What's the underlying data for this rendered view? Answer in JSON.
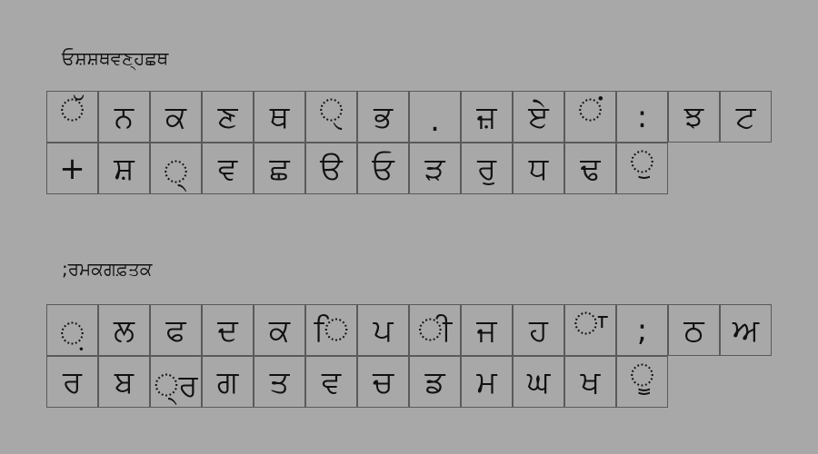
{
  "keyboards": [
    {
      "label": "ਓਸ਼ਸ਼ਥਵਣ੍ਹਛਥ",
      "rows": [
        [
          "ੱ",
          "ਨ",
          "ਕ",
          "ਣ",
          "ਥ",
          "ੑ",
          "ਭ",
          ".",
          "ਜ਼",
          "ਏ",
          "ਂ",
          ":",
          "ਝ",
          "ਟ"
        ],
        [
          "+",
          "ਸ਼",
          "੍",
          "ਵ",
          "ਛ",
          "ੳ",
          "ਓ",
          "ੜ",
          "ਰੁ",
          "ਧ",
          "ਢ",
          "ੁ"
        ]
      ]
    },
    {
      "label": ";ਰਮਕਗਫ਼ਤਕ",
      "rows": [
        [
          "਼",
          "ਲ",
          "ਫ",
          "ਦ",
          "ਕ",
          "ਿ",
          "ਪ",
          "ੀ",
          "ਜ",
          "ਹ",
          "ਾ",
          ";",
          "ਠ",
          "ਅ"
        ],
        [
          "ਰ",
          "ਬ",
          "੍ਰ",
          "ਗ",
          "ਤ",
          "ਵ",
          "ਚ",
          "ਡ",
          "ਮ",
          "ਘ",
          "ਖ",
          "ੂ"
        ]
      ]
    }
  ]
}
